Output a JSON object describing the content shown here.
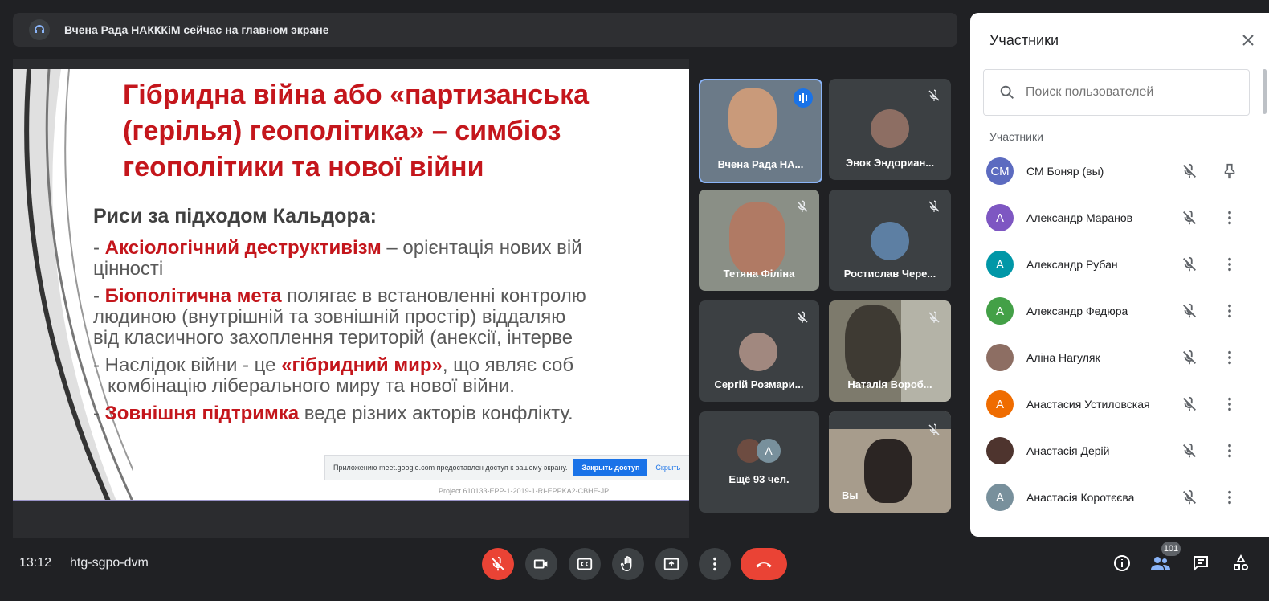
{
  "banner": {
    "text": "Вчена Рада НАКККіМ сейчас на главном экране"
  },
  "slide": {
    "title_lines": [
      "Гібридна війна або «партизанська",
      "(герілья) геополітика» – симбіоз",
      "геополітики та нової війни"
    ],
    "subtitle": "Риси за підходом Кальдора:",
    "p1_dash": "- ",
    "p1_red": "Аксіологічний деструктивізм",
    "p1_rest": " – орієнтація нових вій",
    "p1_line2": "цінності",
    "p2_dash": "- ",
    "p2_red": "Біополітична мета",
    "p2_rest": " полягає в встановленні контролю",
    "p2_line2": "людиною (внутрішній та зовнішній простір) віддаляю",
    "p2_line3": "від класичного захоплення територій (анексії, інтерве",
    "p3_a": "- Наслідок війни - це ",
    "p3_red": "«гібридний мир»",
    "p3_b": ",  що являє соб",
    "p3_line2": "комбінацію ліберального миру та нової війни.",
    "p4_dash": "- ",
    "p4_red": "Зовнішня підтримка",
    "p4_rest": " веде різних акторів конфлікту.",
    "share_text": "Приложению meet.google.com предоставлен доступ к вашему экрану.",
    "share_button": "Закрыть доступ",
    "share_hide": "Скрыть",
    "footer_text": "Project 610133-EPP-1-2019-1-RI-EPPKA2-CBHE-JP"
  },
  "tiles": [
    {
      "name": "Вчена Рада НА..."
    },
    {
      "name": "Эвок Эндориан..."
    },
    {
      "name": "Тетяна Філіна"
    },
    {
      "name": "Ростислав Чере..."
    },
    {
      "name": "Сергій Розмари..."
    },
    {
      "name": "Наталія Вороб..."
    },
    {
      "name": "Ещё 93 чел.",
      "more_avatar": "A"
    },
    {
      "name": "Вы"
    }
  ],
  "panel": {
    "title": "Участники",
    "search_placeholder": "Поиск пользователей",
    "section": "Участники",
    "participants": [
      {
        "name": "СМ Боняр (вы)",
        "initials": "СМ",
        "color": "#5c6bc0"
      },
      {
        "name": "Александр Маранов",
        "initials": "А",
        "color": "#7e57c2"
      },
      {
        "name": "Александр Рубан",
        "initials": "А",
        "color": "#0097a7"
      },
      {
        "name": "Александр Федюра",
        "initials": "А",
        "color": "#43a047"
      },
      {
        "name": "Аліна Нагуляк",
        "initials": "",
        "color": "#8d6e63"
      },
      {
        "name": "Анастасия Устиловская",
        "initials": "А",
        "color": "#ef6c00"
      },
      {
        "name": "Анастасія Дерій",
        "initials": "",
        "color": "#4e342e"
      },
      {
        "name": "Анастасія Коротєєва",
        "initials": "А",
        "color": "#78909c"
      }
    ]
  },
  "bottom": {
    "time": "13:12",
    "meeting_code": "htg-sgpo-dvm",
    "people_count": "101"
  }
}
